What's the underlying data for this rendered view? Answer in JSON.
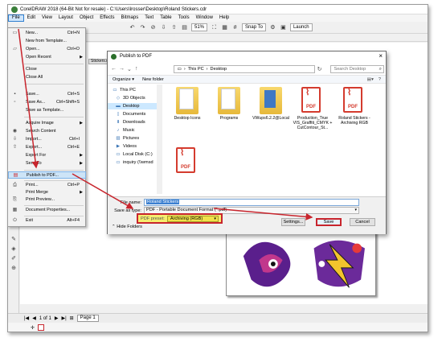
{
  "app": {
    "title": "CorelDRAW 2018 (64-Bit Not for resale) - C:\\Users\\lrosser\\Desktop\\Roland Stickers.cdr",
    "menu": [
      "File",
      "Edit",
      "View",
      "Layout",
      "Object",
      "Effects",
      "Bitmaps",
      "Text",
      "Table",
      "Tools",
      "Window",
      "Help"
    ],
    "toolbar": {
      "zoom": "51%",
      "snap_to": "Snap To",
      "launch": "Launch"
    },
    "doc_tab": "Stickers.c...",
    "status": {
      "page_counter": "1 of 1",
      "page_tab": "Page 1"
    }
  },
  "file_menu": {
    "items": [
      {
        "label": "New...",
        "shortcut": "Ctrl+N",
        "icon": "new-document-icon"
      },
      {
        "label": "New from Template...",
        "shortcut": "",
        "icon": ""
      },
      {
        "label": "Open...",
        "shortcut": "Ctrl+O",
        "icon": "open-folder-icon"
      },
      {
        "label": "Open Recent",
        "shortcut": "",
        "icon": "",
        "submenu": true
      },
      {
        "label": "Close",
        "shortcut": "",
        "icon": ""
      },
      {
        "label": "Close All",
        "shortcut": "",
        "icon": ""
      },
      {
        "label": "Save...",
        "shortcut": "Ctrl+S",
        "icon": "save-icon"
      },
      {
        "label": "Save As...",
        "shortcut": "Ctrl+Shift+S",
        "icon": "save-as-icon"
      },
      {
        "label": "Save as Template...",
        "shortcut": "",
        "icon": ""
      },
      {
        "label": "Acquire Image",
        "shortcut": "",
        "icon": "",
        "submenu": true
      },
      {
        "label": "Search Content",
        "shortcut": "",
        "icon": "search-content-icon"
      },
      {
        "label": "Import...",
        "shortcut": "Ctrl+I",
        "icon": "import-icon"
      },
      {
        "label": "Export...",
        "shortcut": "Ctrl+E",
        "icon": "export-icon"
      },
      {
        "label": "Export For",
        "shortcut": "",
        "icon": "",
        "submenu": true
      },
      {
        "label": "Send To",
        "shortcut": "",
        "icon": "",
        "submenu": true
      },
      {
        "label": "Publish to PDF...",
        "shortcut": "",
        "icon": "pdf-icon",
        "highlighted": true
      },
      {
        "label": "Print...",
        "shortcut": "Ctrl+P",
        "icon": "print-icon"
      },
      {
        "label": "Print Merge",
        "shortcut": "",
        "icon": "",
        "submenu": true
      },
      {
        "label": "Print Preview...",
        "shortcut": "",
        "icon": "print-preview-icon"
      },
      {
        "label": "Document Properties...",
        "shortcut": "",
        "icon": "properties-icon"
      },
      {
        "label": "Exit",
        "shortcut": "Alt+F4",
        "icon": "exit-icon"
      }
    ]
  },
  "dialog": {
    "title": "Publish to PDF",
    "breadcrumb": [
      "This PC",
      "Desktop"
    ],
    "search_placeholder": "Search Desktop",
    "organize": "Organize",
    "new_folder": "New folder",
    "nav_items": [
      "This PC",
      "3D Objects",
      "Desktop",
      "Documents",
      "Downloads",
      "Music",
      "Pictures",
      "Videos",
      "Local Disk (C:)",
      "inquiry (\\\\wmsd"
    ],
    "files": [
      {
        "name": "Desktop Icons",
        "type": "folder"
      },
      {
        "name": "Programs",
        "type": "folder"
      },
      {
        "name": "VWups6.2.2@Local",
        "type": "folder"
      },
      {
        "name": "Production_True VIS_Graffiti_CMYK + CutContour_St...",
        "type": "pdf"
      },
      {
        "name": "Roland Stickers - Archiving RGB",
        "type": "pdf"
      },
      {
        "name": "",
        "type": "pdf"
      }
    ],
    "pdf_label": "PDF",
    "file_name_label": "File name:",
    "file_name_value": "Roland Stickers",
    "save_as_type_label": "Save as type:",
    "save_as_type_value": "PDF - Portable Document Format (*.pdf)",
    "pdf_preset_label": "PDF preset:",
    "pdf_preset_value": "Archiving (RGB)",
    "settings_button": "Settings...",
    "save_button": "Save",
    "cancel_button": "Cancel",
    "hide_folders": "Hide Folders"
  }
}
